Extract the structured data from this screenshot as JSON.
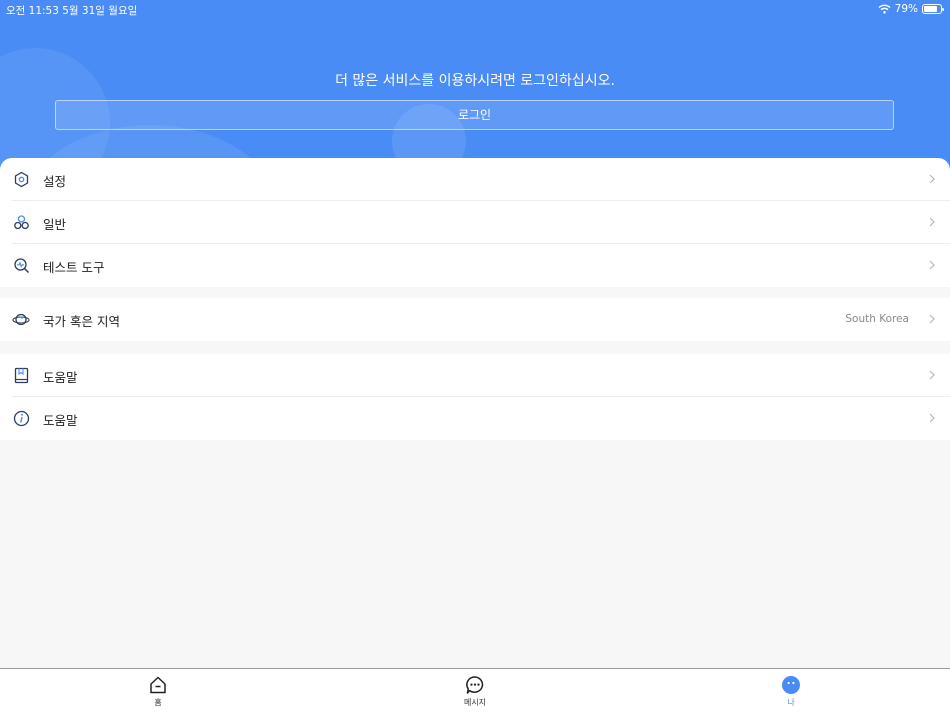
{
  "status_bar": {
    "time_date": "오전 11:53   5월 31일 월요일",
    "battery": "79%",
    "battery_level": 0.79,
    "wifi_icon": "wifi-icon"
  },
  "header": {
    "prompt": "더 많은 서비스를 이용하시려면 로그인하십시오.",
    "login_label": "로그인",
    "background_color": "#4a8cf5"
  },
  "menu": {
    "settings": {
      "label": "설정",
      "icon": "gear-hexagon-icon"
    },
    "general": {
      "label": "일반",
      "icon": "circles-icon"
    },
    "test_tools": {
      "label": "테스트 도구",
      "icon": "magnifier-pulse-icon"
    },
    "region": {
      "label": "국가 혹은 지역",
      "value": "South Korea",
      "icon": "planet-icon"
    },
    "help": {
      "label": "도움말",
      "icon": "book-icon"
    },
    "about": {
      "label": "도움말",
      "icon": "info-icon"
    }
  },
  "tabbar": {
    "home": {
      "label": "홈",
      "icon": "home-icon"
    },
    "messages": {
      "label": "메시지",
      "icon": "chat-icon"
    },
    "me": {
      "label": "나",
      "icon": "profile-icon"
    },
    "active_color": "#4a8cf5"
  }
}
